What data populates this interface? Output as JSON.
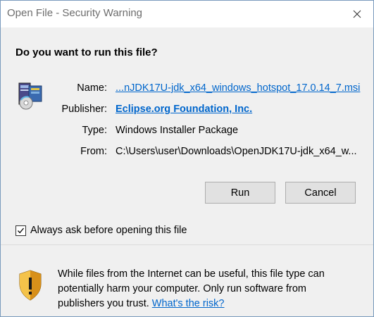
{
  "window": {
    "title": "Open File - Security Warning",
    "close_glyph": "✕"
  },
  "dialog": {
    "heading": "Do you want to run this file?",
    "icon": "installer-package-icon",
    "fields": {
      "name_label": "Name:",
      "name_value": "...nJDK17U-jdk_x64_windows_hotspot_17.0.14_7.msi",
      "publisher_label": "Publisher:",
      "publisher_value": "Eclipse.org Foundation, Inc.",
      "type_label": "Type:",
      "type_value": "Windows Installer Package",
      "from_label": "From:",
      "from_value": "C:\\Users\\user\\Downloads\\OpenJDK17U-jdk_x64_w..."
    },
    "buttons": {
      "run": "Run",
      "cancel": "Cancel"
    },
    "checkbox": {
      "label": "Always ask before opening this file",
      "checked": true
    }
  },
  "warning": {
    "icon": "shield-warning-icon",
    "text": "While files from the Internet can be useful, this file type can potentially harm your computer. Only run software from publishers you trust.",
    "link": "What's the risk?"
  },
  "colors": {
    "link": "#0066cc",
    "panel_bg": "#f0f0f0",
    "button_bg": "#e1e1e1",
    "title_text": "#6d6d6d"
  }
}
